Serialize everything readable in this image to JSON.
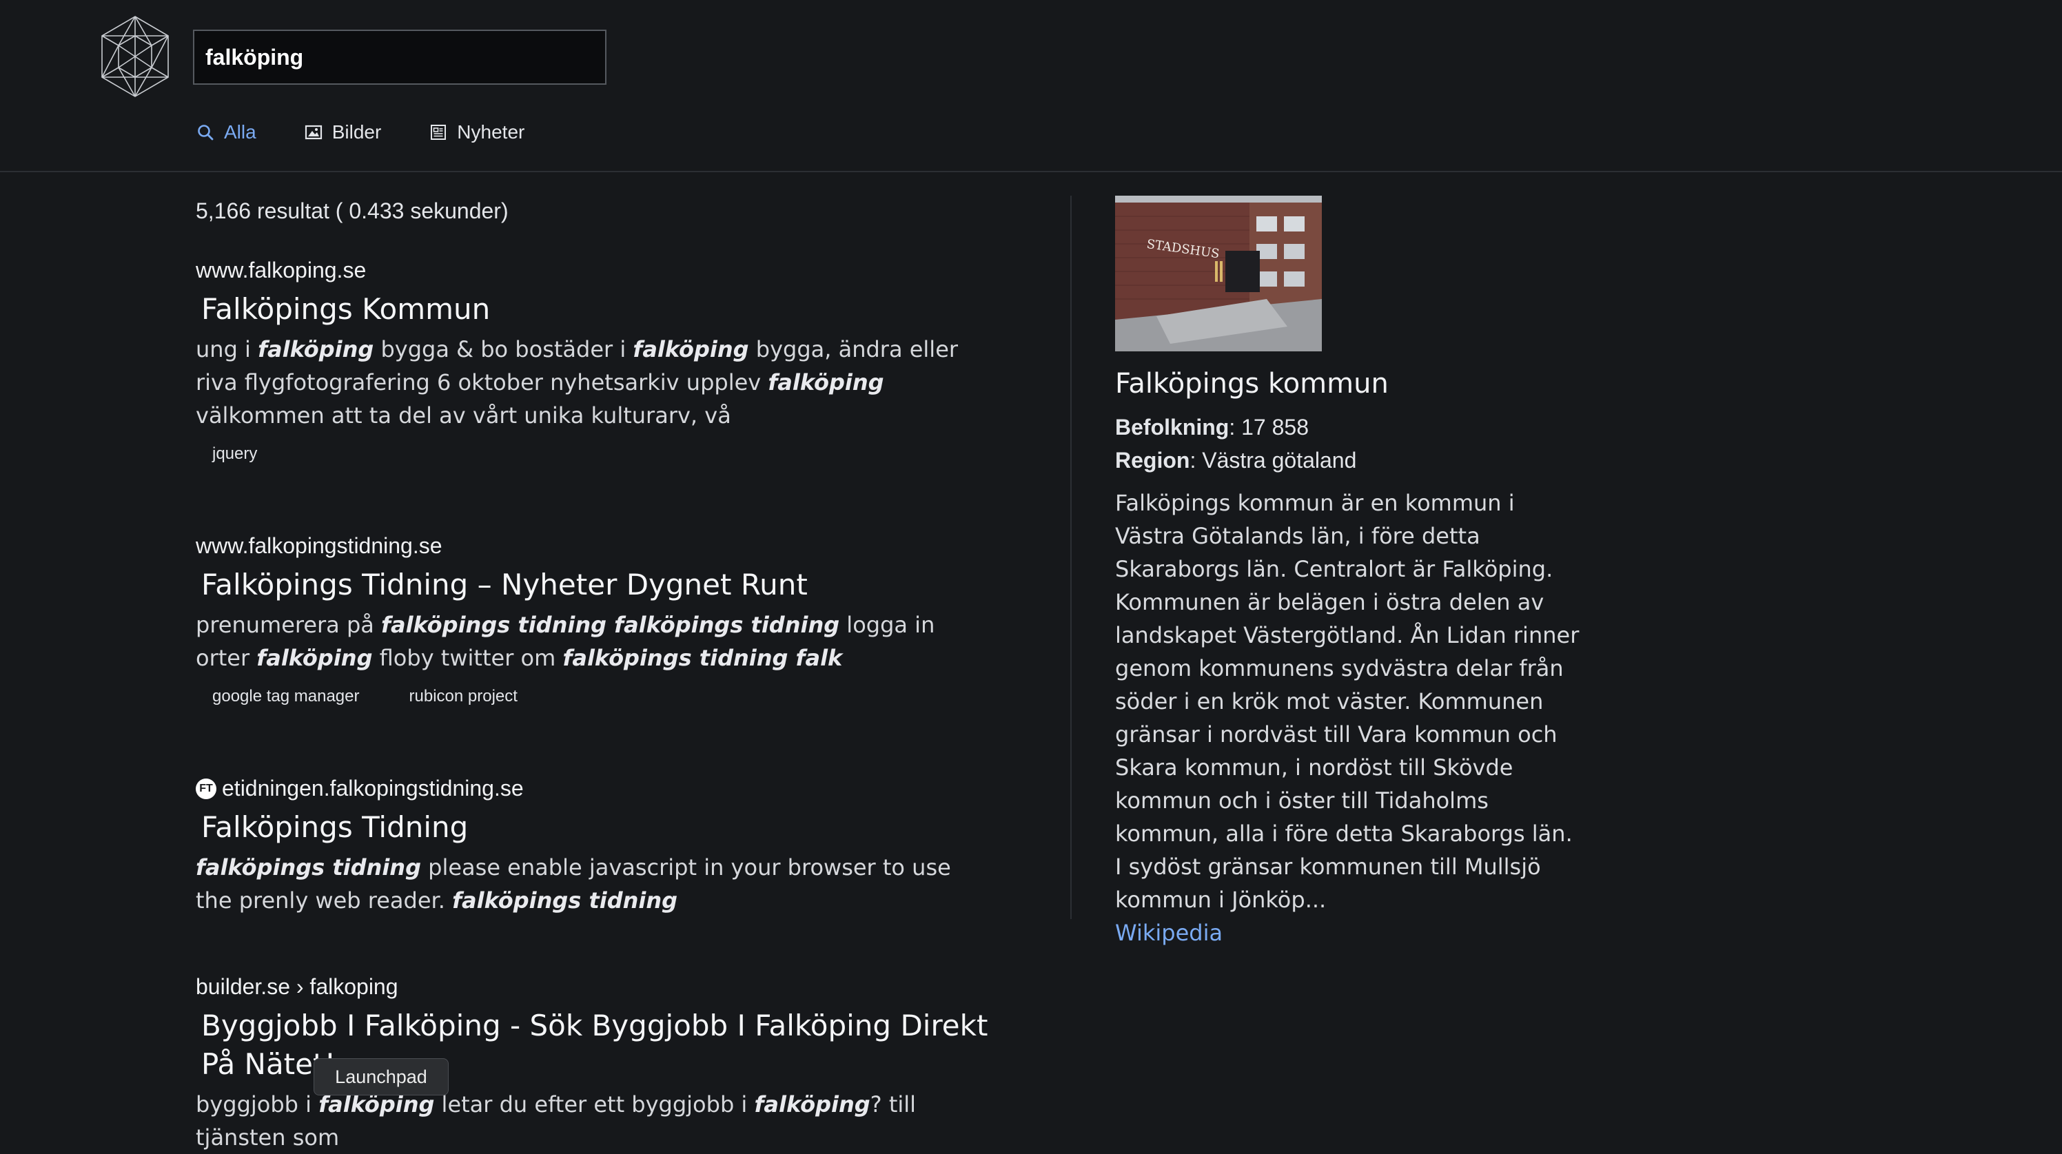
{
  "search": {
    "query": "falköping"
  },
  "tabs": [
    {
      "label": "Alla",
      "icon": "search-icon"
    },
    {
      "label": "Bilder",
      "icon": "image-icon"
    },
    {
      "label": "Nyheter",
      "icon": "news-icon"
    }
  ],
  "results_meta": {
    "stats": "5,166 resultat ( 0.433 sekunder)"
  },
  "results": [
    {
      "url": "www.falkoping.se",
      "title": "Falköpings Kommun",
      "snippet_parts": [
        "ung i ",
        "falköping",
        " bygga & bo bostäder i ",
        "falköping",
        " bygga, ändra eller riva flygfotografering 6 oktober nyhetsarkiv upplev ",
        "falköping",
        " välkommen att ta del av vårt unika kulturarv, vå"
      ],
      "tags": [
        "jquery"
      ]
    },
    {
      "url": "www.falkopingstidning.se",
      "title": "Falköpings Tidning – Nyheter Dygnet Runt",
      "snippet_parts": [
        "prenumerera på ",
        "falköpings tidning falköpings tidning",
        " logga in orter ",
        "falköping",
        " floby twitter om ",
        "falköpings tidning falk"
      ],
      "tags": [
        "google tag manager",
        "rubicon project"
      ]
    },
    {
      "url": "etidningen.falkopingstidning.se",
      "favicon_text": "FT",
      "title": "Falköpings Tidning",
      "snippet_parts": [
        "",
        "falköpings tidning",
        " please enable javascript in your browser to use the prenly web reader. ",
        "falköpings tidning"
      ],
      "tags": []
    },
    {
      "url": "builder.se › falkoping",
      "title": "Byggjobb I Falköping - Sök Byggjobb I Falköping Direkt På Nätet!",
      "snippet_parts": [
        "byggjobb i ",
        "falköping",
        " letar du efter ett byggjobb i ",
        "falköping",
        "? till tjänsten som"
      ],
      "tags": []
    }
  ],
  "knowledge_panel": {
    "image_sign_text": "STADSHUS",
    "title": "Falköpings kommun",
    "facts": [
      {
        "label": "Befolkning",
        "value": ": 17 858"
      },
      {
        "label": "Region",
        "value": ": Västra götaland"
      }
    ],
    "description": "Falköpings kommun är en kommun i Västra Götalands län, i före detta Skaraborgs län. Centralort är Falköping. Kommunen är belägen i östra delen av landskapet Västergötland. Ån Lidan rinner genom kommunens sydvästra delar från söder i en krök mot väster. Kommunen gränsar i nordväst till Vara kommun och Skara kommun, i nordöst till Skövde kommun och i öster till Tidaholms kommun, alla i före detta Skaraborgs län. I sydöst gränsar kommunen till Mullsjö kommun i Jönköp...",
    "source_link": "Wikipedia"
  },
  "tooltip": {
    "label": "Launchpad"
  },
  "colors": {
    "background": "#16181b",
    "accent": "#7aaaf2",
    "text": "#e4e6ea"
  }
}
